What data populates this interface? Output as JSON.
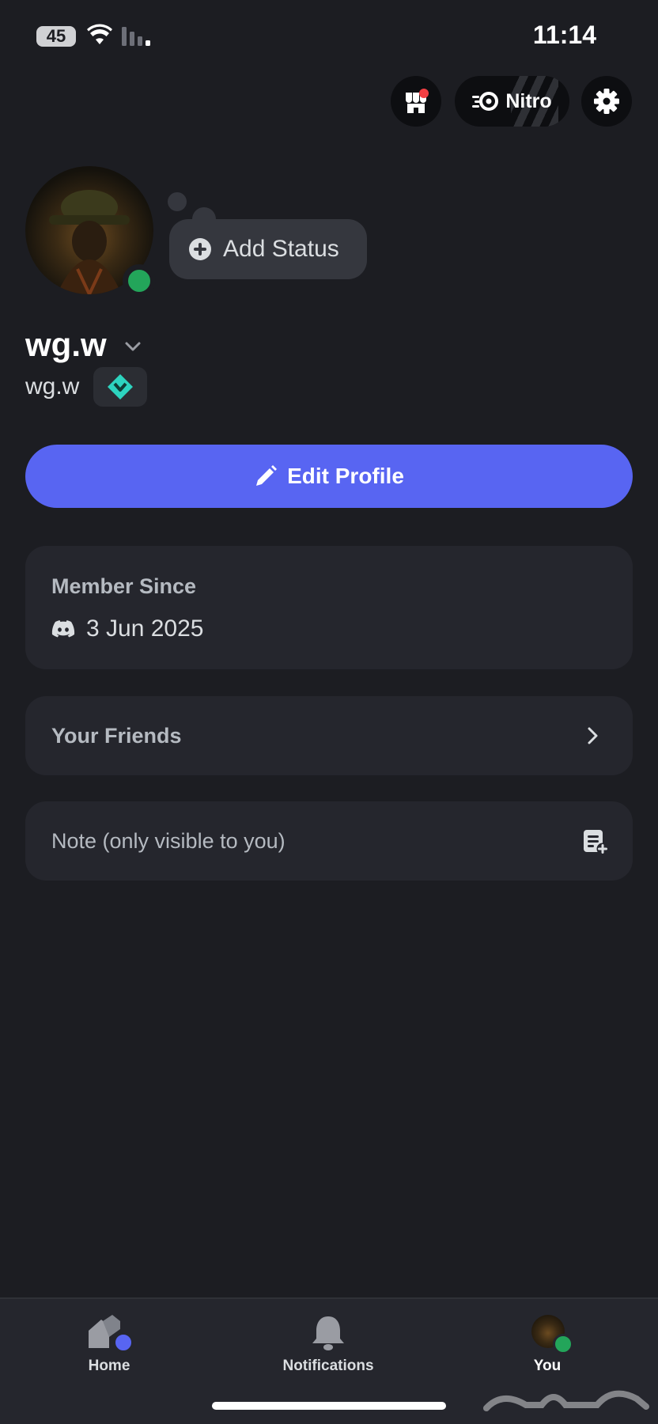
{
  "status_bar": {
    "battery": "45",
    "time": "11:14"
  },
  "header": {
    "nitro_label": "Nitro"
  },
  "profile": {
    "add_status_label": "Add Status",
    "display_name": "wg.w",
    "username": "wg.w"
  },
  "edit_profile_label": "Edit Profile",
  "member_since": {
    "title": "Member Since",
    "date": "3 Jun 2025"
  },
  "friends": {
    "label": "Your Friends"
  },
  "note": {
    "label": "Note (only visible to you)"
  },
  "tabs": [
    {
      "label": "Home",
      "icon": "home-icon"
    },
    {
      "label": "Notifications",
      "icon": "bell-icon"
    },
    {
      "label": "You",
      "icon": "avatar"
    }
  ],
  "colors": {
    "background": "#1c1d22",
    "card": "#25262d",
    "accent": "#5865f2",
    "online": "#23a55a",
    "badge": "#2dd4bf"
  }
}
